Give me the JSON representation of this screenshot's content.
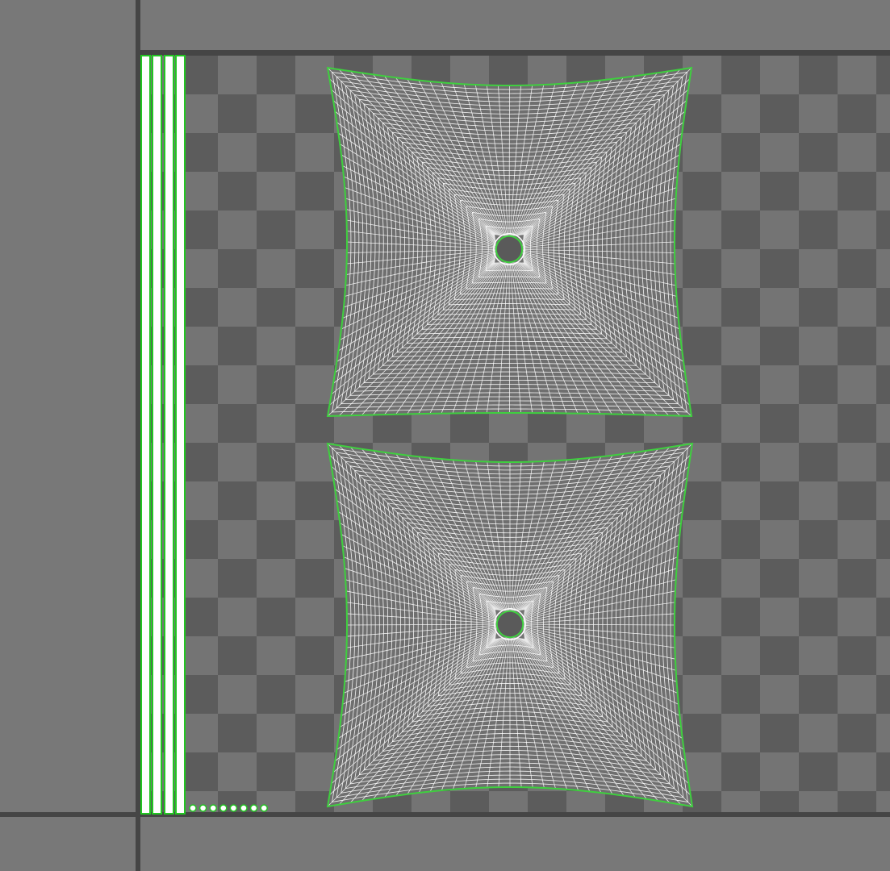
{
  "editor": {
    "view": "uv-texture-editor",
    "background_color": "#787878",
    "checker_colors": [
      "#747474",
      "#5c5c5c"
    ],
    "axis_line_color": "#454545",
    "uv_wire_color": "#ffffff",
    "uv_border_color": "#3fcf3f",
    "selection_color": "#22c522"
  },
  "uv_shells": [
    {
      "id": "cushion-top",
      "type": "radial-quad-patch",
      "selected_border": true
    },
    {
      "id": "cushion-bottom",
      "type": "radial-quad-patch",
      "selected_border": true
    }
  ],
  "strip_shells": {
    "count": 4
  },
  "tiny_shells": {
    "count": 8
  }
}
